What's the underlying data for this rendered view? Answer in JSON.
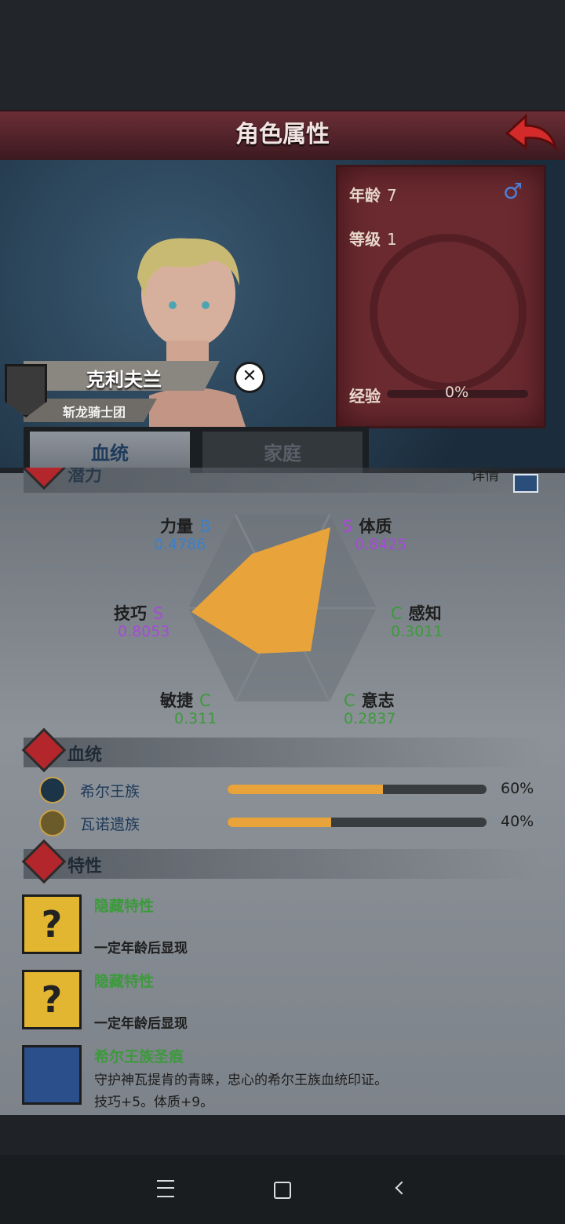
{
  "header": {
    "title": "角色属性"
  },
  "character": {
    "name": "克利夫兰",
    "order": "斩龙骑士团",
    "age_label": "年龄",
    "age": "7",
    "gender_symbol": "♂",
    "level_label": "等级",
    "level": "1",
    "exp_label": "经验",
    "exp_pct": "0%"
  },
  "tabs": [
    {
      "label": "血统",
      "active": true
    },
    {
      "label": "家庭",
      "active": false
    }
  ],
  "potential": {
    "label": "潜力",
    "details_label": "详情"
  },
  "stats": {
    "strength": {
      "name": "力量",
      "grade": "B",
      "value": "0.4786"
    },
    "constitution": {
      "name": "体质",
      "grade": "S",
      "value": "0.8425"
    },
    "skill": {
      "name": "技巧",
      "grade": "S",
      "value": "0.8053"
    },
    "perception": {
      "name": "感知",
      "grade": "C",
      "value": "0.3011"
    },
    "agility": {
      "name": "敏捷",
      "grade": "C",
      "value": "0.311"
    },
    "will": {
      "name": "意志",
      "grade": "C",
      "value": "0.2837"
    }
  },
  "bloodline": {
    "label": "血统",
    "items": [
      {
        "name": "希尔王族",
        "pct": "60%",
        "fraction": 0.6
      },
      {
        "name": "瓦诺遗族",
        "pct": "40%",
        "fraction": 0.4
      }
    ]
  },
  "traits": {
    "label": "特性",
    "items": [
      {
        "title": "隐藏特性",
        "desc": "一定年龄后显现"
      },
      {
        "title": "隐藏特性",
        "desc": "一定年龄后显现"
      },
      {
        "title": "希尔王族圣痕",
        "desc": "守护神瓦提肯的青睐，忠心的希尔王族血统印证。",
        "desc2": "技巧+5。体质+9。"
      }
    ]
  },
  "colors": {
    "accent": "#e8a33a",
    "header": "#6b2d35",
    "grade_S": "#a64bd6",
    "grade_B": "#3d7fc8",
    "grade_C": "#3c9a3c"
  }
}
